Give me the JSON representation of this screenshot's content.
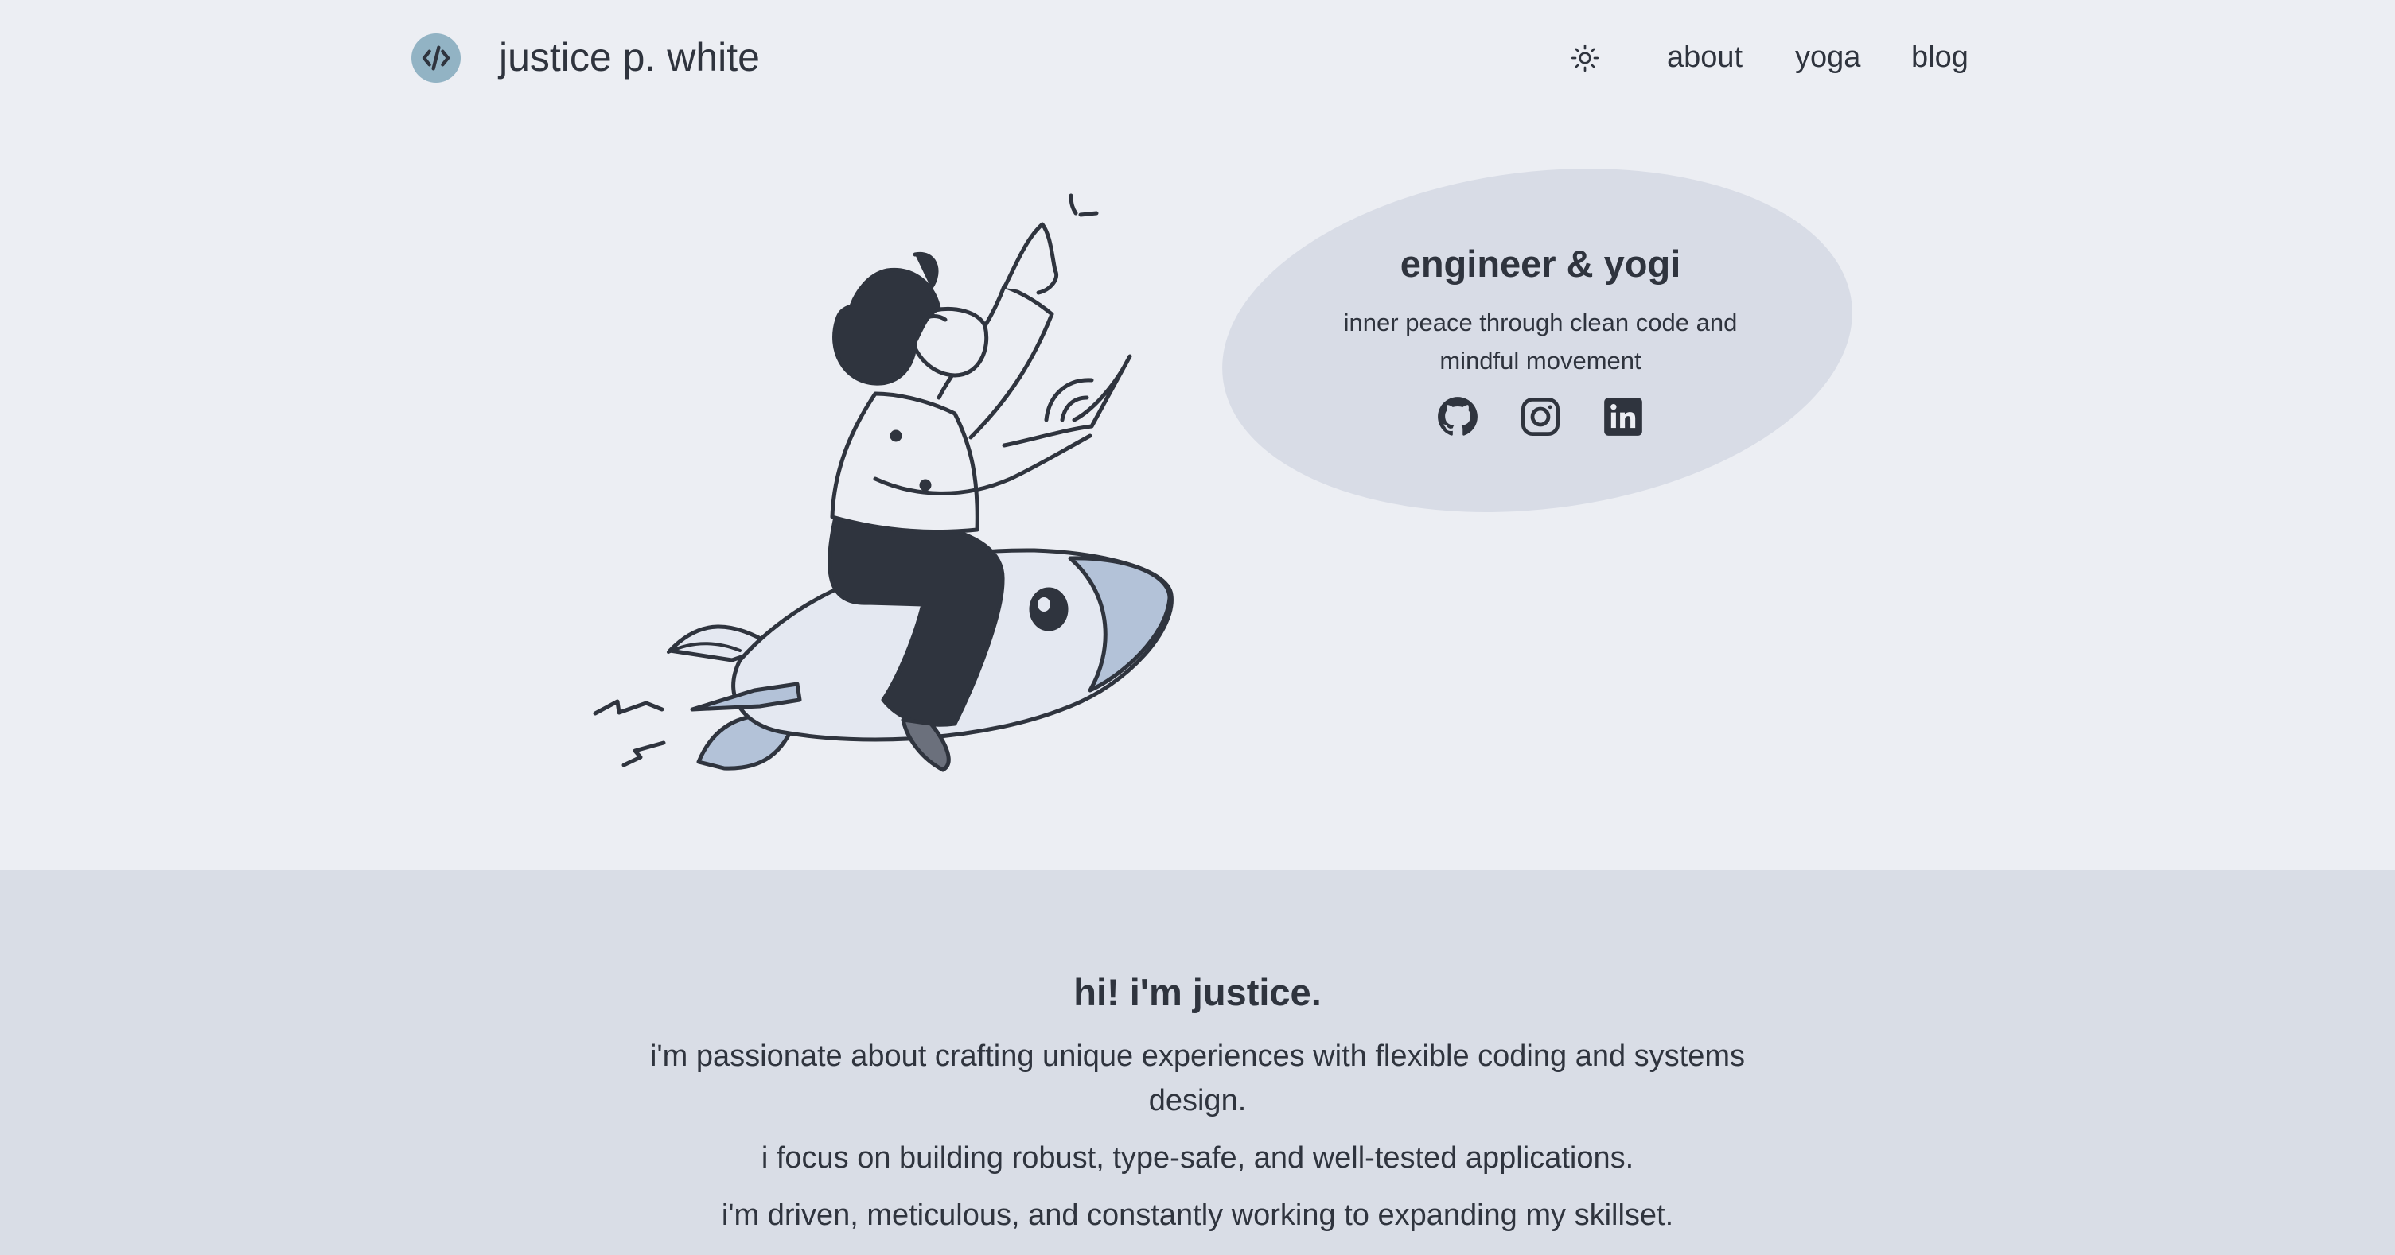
{
  "header": {
    "title": "justice p. white",
    "logo_icon": "code-icon",
    "theme_toggle_icon": "sun-icon",
    "nav": [
      {
        "label": "about"
      },
      {
        "label": "yoga"
      },
      {
        "label": "blog"
      }
    ]
  },
  "hero": {
    "heading": "engineer & yogi",
    "tagline": "inner peace through clean code and mindful movement",
    "illustration": "person-riding-rocket-illustration",
    "social_icons": [
      "github-icon",
      "instagram-icon",
      "linkedin-icon"
    ]
  },
  "intro": {
    "heading": "hi! i'm justice.",
    "paragraphs": [
      "i'm passionate about crafting unique experiences with flexible coding and systems design.",
      "i focus on building robust, type-safe, and well-tested applications.",
      "i'm driven, meticulous, and constantly working to expanding my skillset."
    ]
  },
  "colors": {
    "background": "#eceef3",
    "section_background": "#d9dde6",
    "text": "#2f343e",
    "logo_badge": "#92b3c4",
    "rocket_accent": "#b3c2d8"
  }
}
